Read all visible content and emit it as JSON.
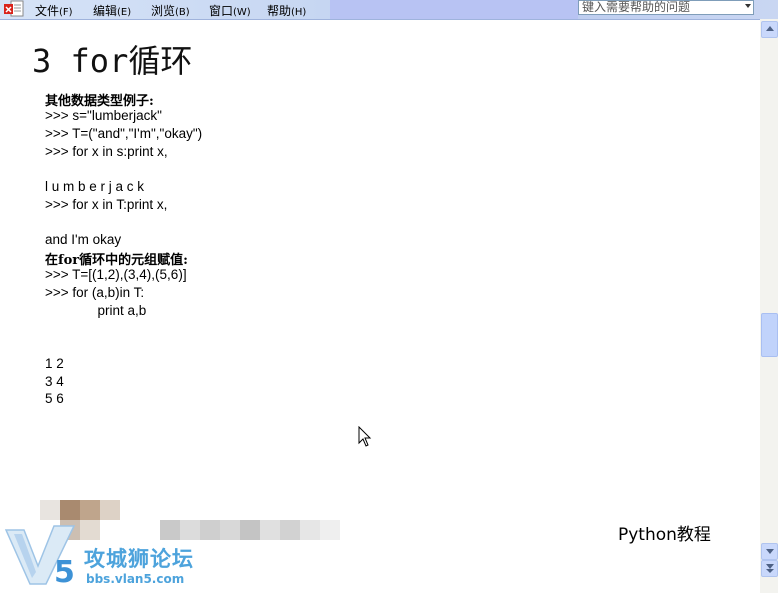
{
  "menubar": {
    "items": [
      {
        "label": "文件",
        "hotkey": "(F)"
      },
      {
        "label": "编辑",
        "hotkey": "(E)"
      },
      {
        "label": "浏览",
        "hotkey": "(B)"
      },
      {
        "label": "窗口",
        "hotkey": "(W)"
      },
      {
        "label": "帮助",
        "hotkey": "(H)"
      }
    ],
    "help_placeholder": "键入需要帮助的问题"
  },
  "slide": {
    "title": "3 for循环",
    "lines": [
      "其他数据类型例子:",
      ">>> s=\"lumberjack\"",
      ">>> T=(\"and\",\"I'm\",\"okay\")",
      ">>> for x in s:print x,",
      "l u m b e r j a c k",
      ">>> for x in T:print x,",
      "and I'm okay",
      "在for循环中的元组赋值:",
      ">>> T=[(1,2),(3,4),(5,6)]",
      ">>> for (a,b)in T:",
      "              print a,b",
      "1 2",
      "3 4",
      "5 6"
    ],
    "footer": "Python教程"
  },
  "watermark": {
    "name": "攻城狮论坛",
    "url": "bbs.vlan5.com"
  },
  "colors": {
    "menubar": "#c7d7f2",
    "logo_blue": "#4da3dc"
  }
}
